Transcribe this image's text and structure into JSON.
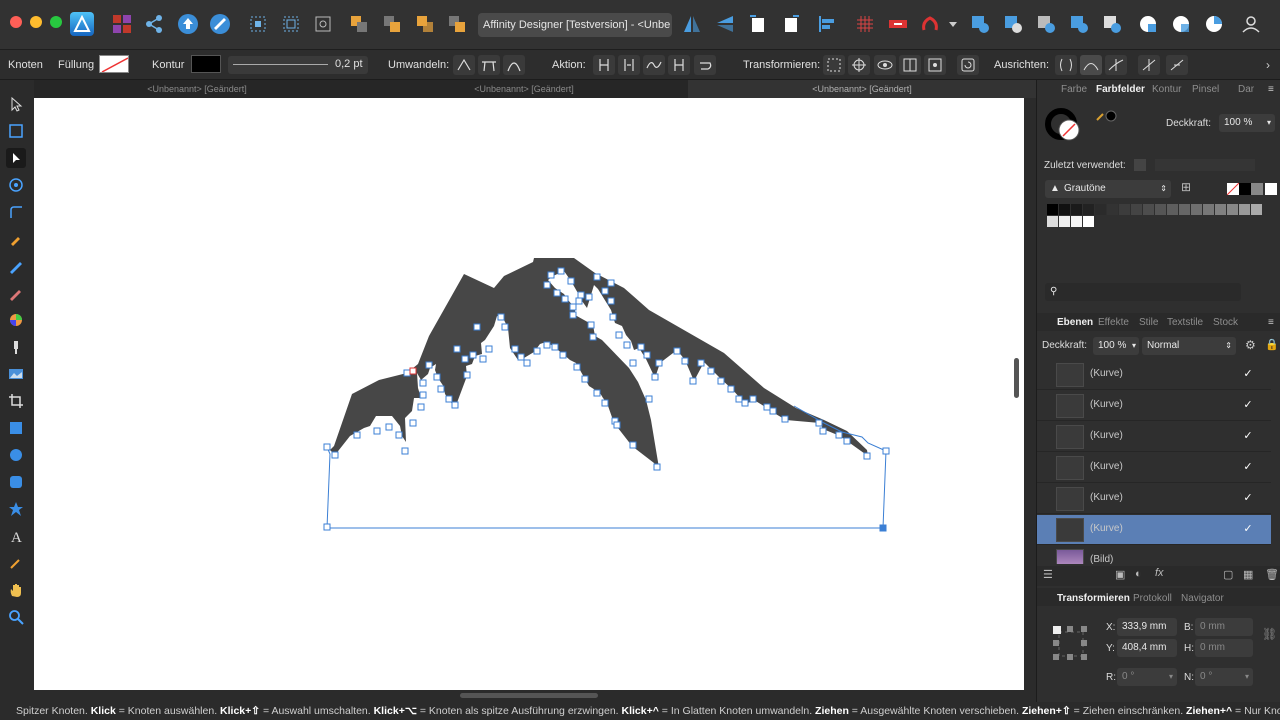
{
  "app": {
    "title": "Affinity Designer [Testversion] - <Unbe",
    "title_star": "★"
  },
  "colors": {
    "accent": "#2a8bd6",
    "selection_blue": "#5b7fb5",
    "node_outline": "#3b7fd4",
    "shape_fill": "#474747"
  },
  "context_toolbar": {
    "tool_name": "Knoten",
    "fill_label": "Füllung",
    "stroke_label": "Kontur",
    "stroke_width": "0,2 pt",
    "convert_label": "Umwandeln:",
    "action_label": "Aktion:",
    "transform_label": "Transformieren:",
    "align_label": "Ausrichten:"
  },
  "doc_tabs": [
    {
      "label": "<Unbenannt> [Geändert]"
    },
    {
      "label": "<Unbenannt> [Geändert]"
    },
    {
      "label": "<Unbenannt> [Geändert]"
    }
  ],
  "tools": [
    {
      "name": "move-tool-icon"
    },
    {
      "name": "artboard-tool-icon"
    },
    {
      "name": "node-tool-icon"
    },
    {
      "name": "point-transform-tool-icon"
    },
    {
      "name": "corner-tool-icon"
    },
    {
      "name": "pen-tool-icon"
    },
    {
      "name": "pencil-tool-icon"
    },
    {
      "name": "vector-brush-tool-icon"
    },
    {
      "name": "fill-tool-icon"
    },
    {
      "name": "transparency-tool-icon"
    },
    {
      "name": "place-image-tool-icon"
    },
    {
      "name": "crop-tool-icon"
    },
    {
      "name": "rectangle-tool-icon"
    },
    {
      "name": "ellipse-tool-icon"
    },
    {
      "name": "rounded-rectangle-tool-icon"
    },
    {
      "name": "star-tool-icon"
    },
    {
      "name": "text-tool-icon"
    },
    {
      "name": "color-picker-tool-icon"
    },
    {
      "name": "hand-tool-icon"
    },
    {
      "name": "zoom-tool-icon"
    }
  ],
  "color_panel": {
    "tabs": [
      "Farbe",
      "Farbfelder",
      "Kontur",
      "Pinsel",
      "Dar"
    ],
    "active_tab": "Farbfelder",
    "opacity_label": "Deckkraft:",
    "opacity_value": "100 %",
    "recent_label": "Zuletzt verwendet:",
    "palette_name": "Grautöne"
  },
  "layers_panel": {
    "tabs": [
      "Ebenen",
      "Effekte",
      "Stile",
      "Textstile",
      "Stock"
    ],
    "active_tab": "Ebenen",
    "opacity_label": "Deckkraft:",
    "opacity_value": "100 %",
    "blend_mode": "Normal",
    "layers": [
      {
        "name": "(Kurve)",
        "visible": "✓"
      },
      {
        "name": "(Kurve)",
        "visible": "✓"
      },
      {
        "name": "(Kurve)",
        "visible": "✓"
      },
      {
        "name": "(Kurve)",
        "visible": "✓"
      },
      {
        "name": "(Kurve)",
        "visible": "✓"
      },
      {
        "name": "(Kurve)",
        "visible": "✓"
      },
      {
        "name": "(Bild)",
        "visible": ""
      }
    ],
    "selected_index": 5
  },
  "transform_panel": {
    "tabs": [
      "Transformieren",
      "Protokoll",
      "Navigator"
    ],
    "active_tab": "Transformieren",
    "x_label": "X:",
    "x_value": "333,9 mm",
    "y_label": "Y:",
    "y_value": "408,4 mm",
    "b_label": "B:",
    "b_value": "0 mm",
    "h_label": "H:",
    "h_value": "0 mm",
    "r_label": "R:",
    "r_value": "0 °",
    "n_label": "N:",
    "n_value": "0 °"
  },
  "status": {
    "s1": "Spitzer Knoten. ",
    "k1": "Klick",
    "s2": " = Knoten auswählen. ",
    "k2": "Klick+⇧",
    "s3": " = Auswahl umschalten. ",
    "k3": "Klick+⌥",
    "s4": " = Knoten als spitze Ausführung erzwingen. ",
    "k4": "Klick+^",
    "s5": " = In Glatten Knoten umwandeln. ",
    "k5": "Ziehen",
    "s6": " = Ausgewählte Knoten verschieben. ",
    "k6": "Ziehen+⇧",
    "s7": " = Ziehen einschränken. ",
    "k7": "Ziehen+^",
    "s8": " = Nur Knoten versch"
  }
}
